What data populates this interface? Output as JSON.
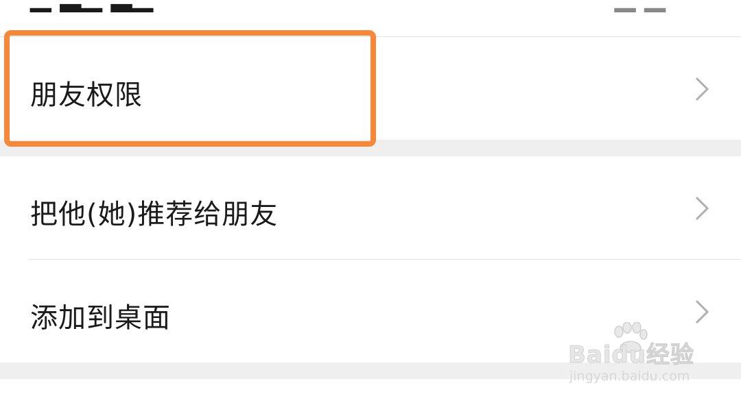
{
  "top_row": {
    "label": "",
    "value": ""
  },
  "rows": [
    {
      "label": "朋友权限"
    },
    {
      "label": "把他(她)推荐给朋友"
    },
    {
      "label": "添加到桌面"
    }
  ],
  "colors": {
    "highlight": "#f6883a",
    "section_gap": "#efefef",
    "chevron": "#b0b0b0"
  },
  "icons": {
    "chevron": "chevron-right-icon"
  },
  "watermark": {
    "brand": "Baidu经验",
    "url": "jingyan.baidu.com"
  }
}
